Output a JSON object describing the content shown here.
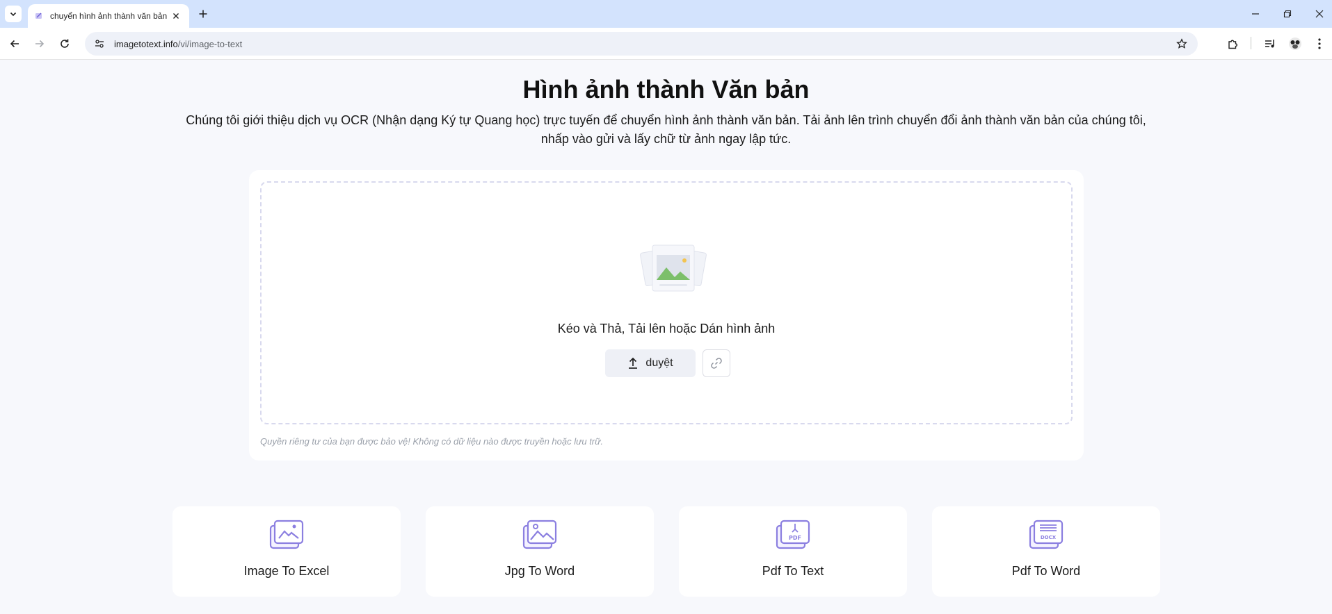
{
  "browser": {
    "tab_title": "chuyển hình ảnh thành văn bản",
    "url_host": "imagetotext.info",
    "url_path": "/vi/image-to-text"
  },
  "page": {
    "title": "Hình ảnh thành Văn bản",
    "description": "Chúng tôi giới thiệu dịch vụ OCR (Nhận dạng Ký tự Quang học) trực tuyến để chuyển hình ảnh thành văn bản. Tải ảnh lên trình chuyển đổi ảnh thành văn bản của chúng tôi, nhấp vào gửi và lấy chữ từ ảnh ngay lập tức."
  },
  "upload": {
    "prompt": "Kéo và Thả, Tải lên hoặc Dán hình ảnh",
    "browse_label": "duyệt",
    "privacy_note": "Quyền riêng tư của bạn được bảo vệ! Không có dữ liệu nào được truyền hoặc lưu trữ."
  },
  "tools": [
    {
      "label": "Image To Excel",
      "icon": "image-excel-icon"
    },
    {
      "label": "Jpg To Word",
      "icon": "jpg-word-icon"
    },
    {
      "label": "Pdf To Text",
      "icon": "pdf-icon"
    },
    {
      "label": "Pdf To Word",
      "icon": "docx-icon"
    }
  ],
  "colors": {
    "accent": "#8b7fe0",
    "tabbar": "#d3e3fd",
    "page_bg": "#f7f8fc"
  }
}
